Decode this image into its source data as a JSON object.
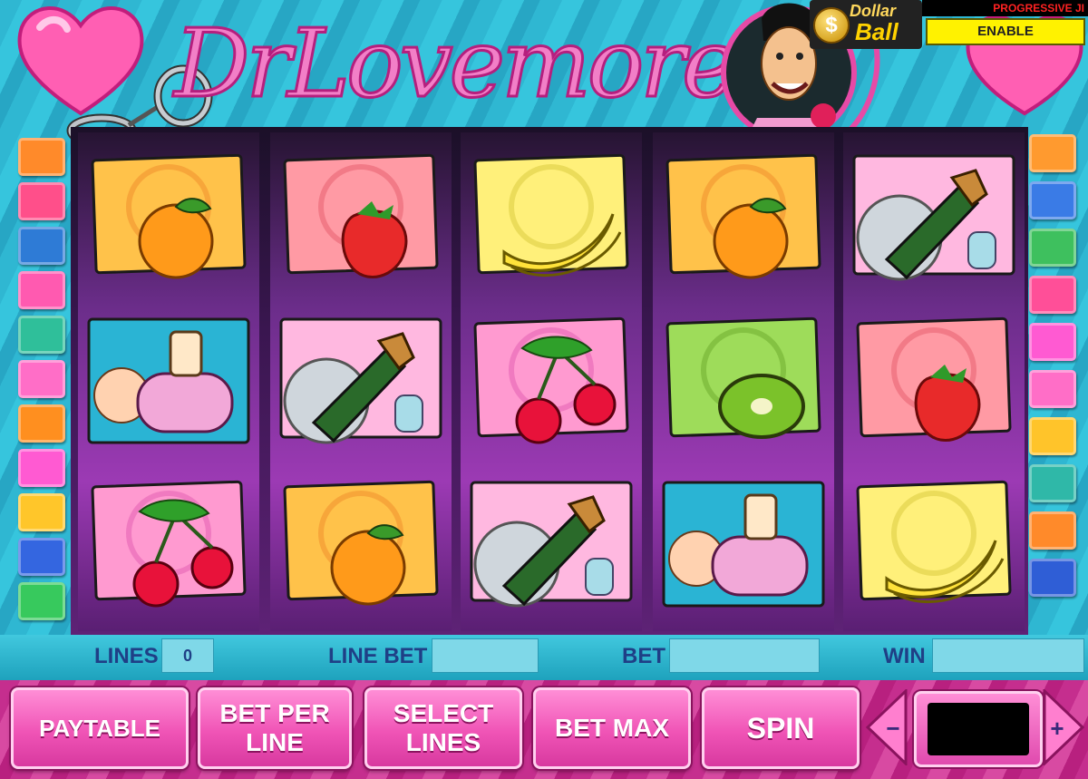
{
  "game": {
    "logo_text": "DrLovemore"
  },
  "jackpot": {
    "ball_brand_top": "Dollar",
    "ball_brand_bottom": "Ball",
    "ball_symbol": "$",
    "label": "PROGRESSIVE JІ",
    "enable_label": "ENABLE"
  },
  "info_bar": {
    "lines_label": "LINES",
    "lines_value": "0",
    "line_bet_label": "LINE BET",
    "line_bet_value": "",
    "bet_label": "BET",
    "bet_value": "",
    "win_label": "WIN",
    "win_value": ""
  },
  "controls": {
    "paytable": "PAYTABLE",
    "bet_per_line_1": "BET PER",
    "bet_per_line_2": "LINE",
    "select_lines_1": "SELECT",
    "select_lines_2": "LINES",
    "bet_max": "BET MAX",
    "spin": "SPIN",
    "decrease": "−",
    "increase": "+",
    "stake_value": ""
  },
  "reels": [
    [
      "orange",
      "perfume",
      "cherry"
    ],
    [
      "strawberry",
      "champagne",
      "orange"
    ],
    [
      "banana",
      "cherry",
      "champagne"
    ],
    [
      "orange",
      "kiwi",
      "perfume"
    ],
    [
      "champagne",
      "strawberry",
      "banana"
    ]
  ],
  "colors": {
    "accent_pink": "#f054b6",
    "info_text": "#1f3f86",
    "jackpot_yellow": "#fff200"
  },
  "line_markers": {
    "left": [
      "#ff8a2a",
      "#ff4f8a",
      "#2e7bd6",
      "#ff5ab0",
      "#2fbf9a",
      "#ff6ec7",
      "#ff8f1f",
      "#ff5ad2",
      "#ffc62a",
      "#3466e0",
      "#37c95d"
    ],
    "right": [
      "#ff9a2f",
      "#3a7be6",
      "#3ec05e",
      "#ff4f98",
      "#ff5ad2",
      "#ff6ec7",
      "#ffc42a",
      "#2fb8a8",
      "#ff8a2a",
      "#2f5ed6"
    ]
  }
}
